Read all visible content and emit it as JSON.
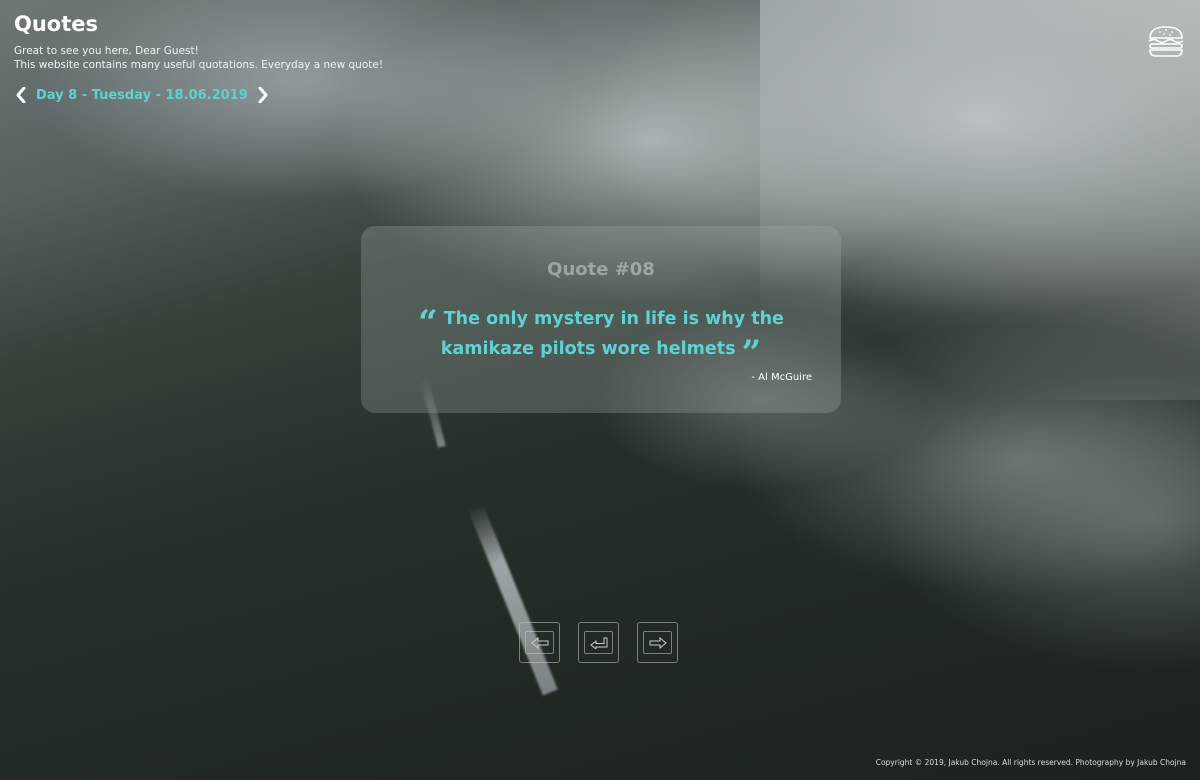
{
  "header": {
    "title": "Quotes",
    "greeting": "Great to see you here, Dear Guest!",
    "description": "This website contains many useful quotations. Everyday a new quote!"
  },
  "day_nav": {
    "label": "Day 8 - Tuesday - 18.06.2019",
    "prev_icon": "chevron-left-icon",
    "next_icon": "chevron-right-icon"
  },
  "menu": {
    "icon": "burger-icon"
  },
  "quote": {
    "number_label": "Quote #08",
    "text": "The only mystery in life is why the kamikaze pilots wore helmets",
    "author": "- Al McGuire"
  },
  "controls": {
    "prev_icon": "arrow-left-key-icon",
    "enter_icon": "enter-key-icon",
    "next_icon": "arrow-right-key-icon"
  },
  "footer": {
    "copyright": "Copyright © 2019, Jakub Chojna. All rights reserved. Photography by Jakub Chojna"
  },
  "colors": {
    "accent": "#5fd2d3",
    "text": "#ffffff"
  }
}
